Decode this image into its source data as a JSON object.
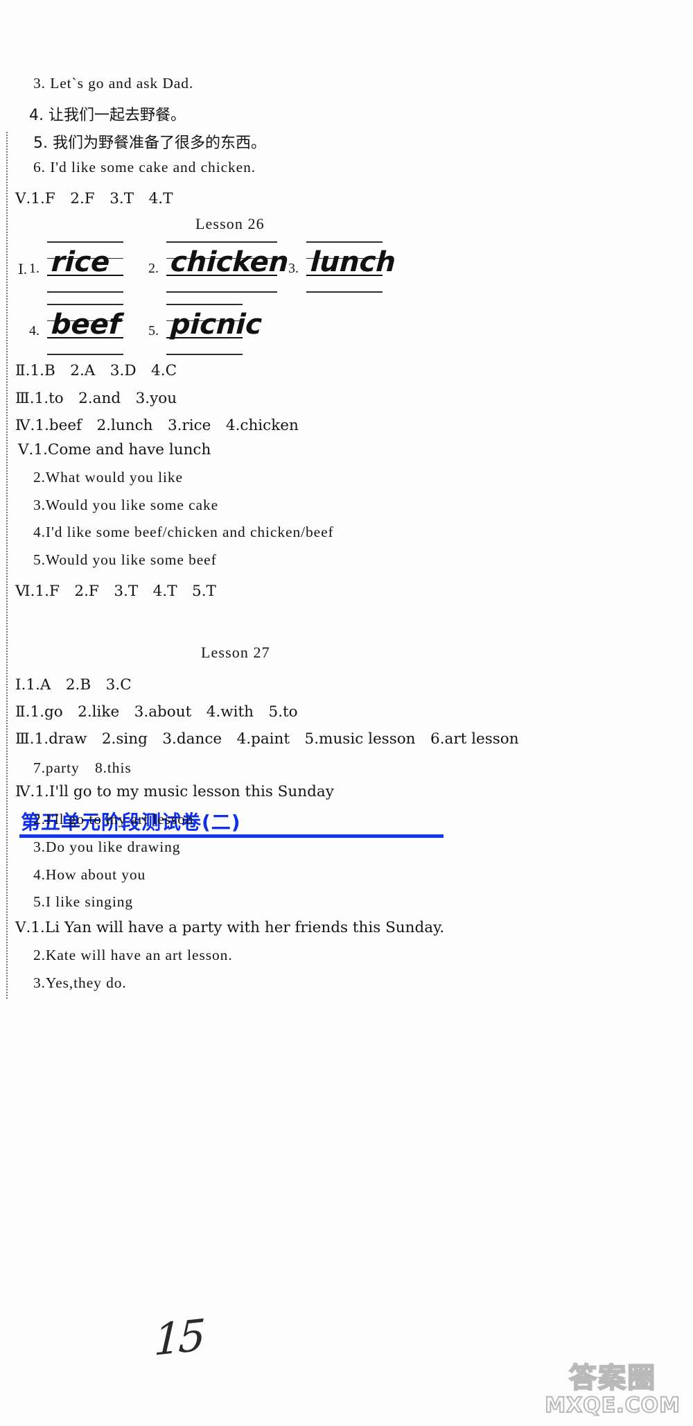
{
  "document": {
    "page_number": "15",
    "watermark": {
      "cn": "答案圈",
      "en": "MXQE.COM"
    }
  },
  "top_section": {
    "items": [
      {
        "id": "t3",
        "text": "3. Let`s go and ask Dad."
      },
      {
        "id": "t4",
        "text": "4. 让我们一起去野餐。",
        "lang": "cn"
      },
      {
        "id": "t5",
        "text": "5. 我们为野餐准备了很多的东西。",
        "lang": "cn"
      },
      {
        "id": "t6",
        "text": "6. I'd like some cake and chicken."
      },
      {
        "id": "t7",
        "text": "Ⅴ.1.F　2.F　3.T　4.T"
      }
    ]
  },
  "lesson26": {
    "heading": "Lesson 26",
    "section1_label": "Ⅰ.",
    "handwriting": [
      {
        "index": "1.",
        "word": "rice"
      },
      {
        "index": "2.",
        "word": "chicken"
      },
      {
        "index": "3.",
        "word": "lunch"
      },
      {
        "index": "4.",
        "word": "beef"
      },
      {
        "index": "5.",
        "word": "picnic"
      }
    ],
    "answers": [
      {
        "id": "l26-2",
        "text": "Ⅱ.1.B　2.A　3.D　4.C"
      },
      {
        "id": "l26-3",
        "text": "Ⅲ.1.to　2.and　3.you"
      },
      {
        "id": "l26-4",
        "text": "Ⅳ.1.beef　2.lunch　3.rice　4.chicken"
      },
      {
        "id": "l26-5a",
        "text": "Ⅴ.1.Come and have lunch"
      },
      {
        "id": "l26-5b",
        "text": "2.What would you like"
      },
      {
        "id": "l26-5c",
        "text": "3.Would you like some cake"
      },
      {
        "id": "l26-5d",
        "text": "4.I'd like some beef/chicken and chicken/beef"
      },
      {
        "id": "l26-5e",
        "text": "5.Would you like some beef"
      },
      {
        "id": "l26-6",
        "text": "Ⅵ.1.F　2.F　3.T　4.T　5.T"
      }
    ]
  },
  "unit_test": {
    "title": "第五单元阶段测试卷(二)",
    "accent_color": "#1535ee"
  },
  "lesson27": {
    "heading": "Lesson 27",
    "answers": [
      {
        "id": "l27-1",
        "text": "Ⅰ.1.A　2.B　3.C"
      },
      {
        "id": "l27-2",
        "text": "Ⅱ.1.go　2.like　3.about　4.with　5.to"
      },
      {
        "id": "l27-3a",
        "text": "Ⅲ.1.draw　2.sing　3.dance　4.paint　5.music lesson　6.art lesson"
      },
      {
        "id": "l27-3b",
        "text": "7.party　8.this"
      },
      {
        "id": "l27-4a",
        "text": "Ⅳ.1.I'll go to my music lesson this Sunday"
      },
      {
        "id": "l27-4b",
        "text": "2.I'll go to my art lesson"
      },
      {
        "id": "l27-4c",
        "text": "3.Do you like drawing"
      },
      {
        "id": "l27-4d",
        "text": "4.How about you"
      },
      {
        "id": "l27-4e",
        "text": "5.I like singing"
      },
      {
        "id": "l27-5a",
        "text": "Ⅴ.1.Li Yan will have a party with her friends this Sunday."
      },
      {
        "id": "l27-5b",
        "text": "2.Kate will have an art lesson."
      },
      {
        "id": "l27-5c",
        "text": "3.Yes,they do."
      }
    ]
  }
}
